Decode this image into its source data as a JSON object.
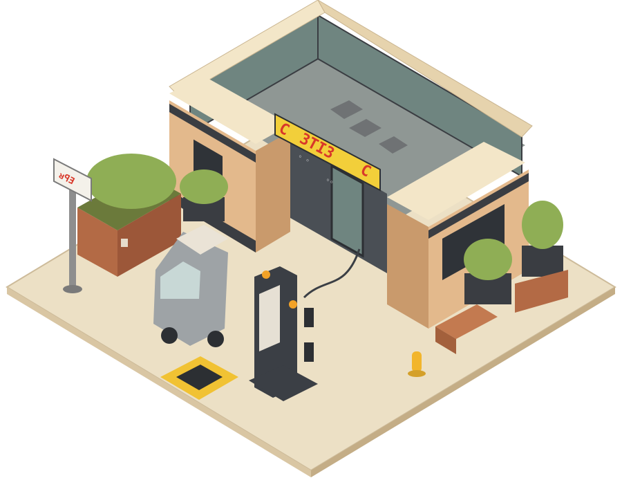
{
  "scene": {
    "storefront_sign": "3TI3",
    "sign_glyph_left": "C",
    "sign_glyph_right": "C",
    "roadside_sign": "ᴚꟼƎ",
    "door_panel_top": "◦ ◦",
    "door_panel_bottom": "◦◦"
  },
  "colors": {
    "ground": "#ece0c5",
    "ground_edge": "#cdbb9a",
    "brick": "#e3b98c",
    "brick_dark": "#c99a6c",
    "trim_light": "#f3e6c8",
    "trim_dark": "#3a3d42",
    "sign_yellow": "#f2cf3a",
    "sign_red": "#d8382a",
    "glass": "#6f8580",
    "planter": "#b36a45",
    "foliage": "#8fae55",
    "ev_post": "#3b3f45",
    "road_mark": "#f1c233"
  },
  "icons": [
    "bollard-icon",
    "charging-station-icon",
    "vehicle-icon",
    "planter-icon",
    "road-marking-icon"
  ]
}
